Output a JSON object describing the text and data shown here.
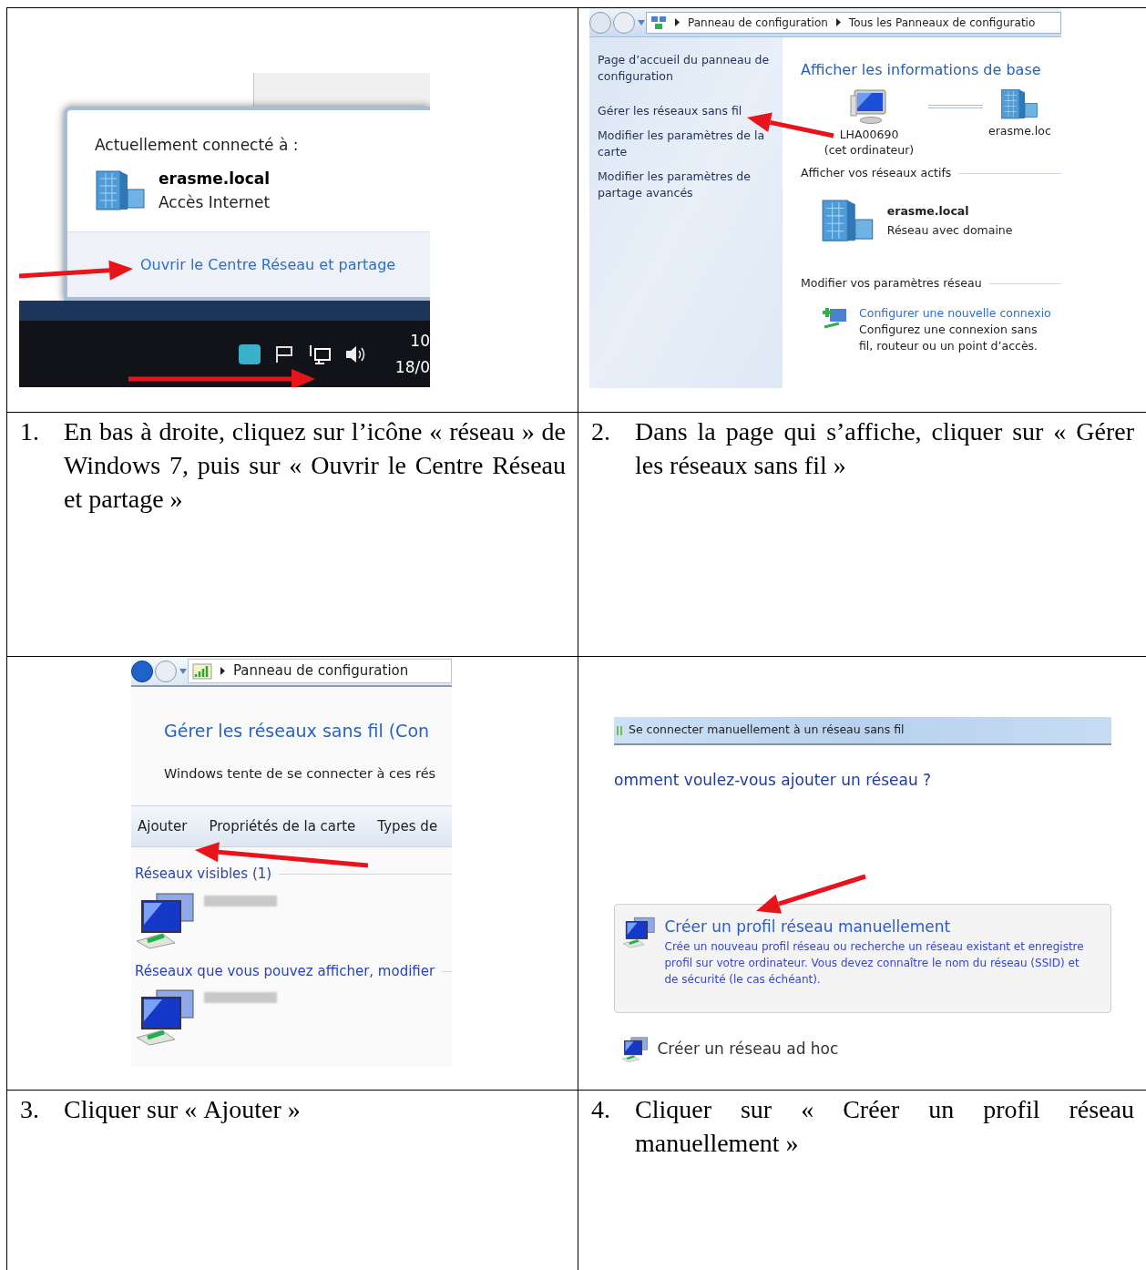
{
  "steps": [
    {
      "number": "1.",
      "caption": "En bas à droite, cliquez sur l’icône « réseau » de Windows 7, puis sur « Ouvrir le Centre Réseau et partage »",
      "screenshot": {
        "kind": "tray_popup",
        "heading": "Actuellement connecté à :",
        "network": "erasme.local",
        "status": "Accès Internet",
        "link": "Ouvrir le Centre Réseau et partage",
        "time": "10",
        "date": "18/0"
      }
    },
    {
      "number": "2.",
      "caption": "Dans la page qui s’affiche, cliquer sur « Gérer les réseaux sans fil »",
      "screenshot": {
        "kind": "network_center",
        "breadcrumb": [
          "Panneau de configuration",
          "Tous les Panneaux de configuratio"
        ],
        "sidebar": [
          "Page d’accueil du panneau de configuration",
          "Gérer les réseaux sans fil",
          "Modifier les paramètres de la carte",
          "Modifier les paramètres de partage avancés"
        ],
        "title": "Afficher les informations de base",
        "computer": "LHA00690",
        "computer_note": "(cet ordinateur)",
        "map_network": "erasme.loc",
        "active_header": "Afficher vos réseaux actifs",
        "active_name": "erasme.local",
        "active_type": "Réseau avec domaine",
        "settings_header": "Modifier vos paramètres réseau",
        "task_link": "Configurer une nouvelle connexio",
        "task_desc": "Configurez une connexion sans fil, routeur ou un point d’accès."
      }
    },
    {
      "number": "3.",
      "caption": "Cliquer sur « Ajouter »",
      "screenshot": {
        "kind": "wireless_networks",
        "breadcrumb": [
          "Panneau de configuration"
        ],
        "title": "Gérer les réseaux sans fil (Con",
        "subtitle": "Windows tente de se connecter à ces rés",
        "toolbar": [
          "Ajouter",
          "Propriétés de la carte",
          "Types de"
        ],
        "groups": [
          "Réseaux visibles (1)",
          "Réseaux que vous pouvez afficher, modifier"
        ]
      }
    },
    {
      "number": "4.",
      "caption": "Cliquer sur « Créer un profil réseau manuellement »",
      "screenshot": {
        "kind": "manual_connect",
        "window_title": "Se connecter manuellement à un réseau sans fil",
        "question": "omment voulez-vous ajouter un réseau ?",
        "options": [
          {
            "title": "Créer un profil réseau manuellement",
            "description": [
              "Crée un nouveau profil réseau ou recherche un réseau existant et enregistre",
              "profil sur votre ordinateur. Vous devez connaître le nom du réseau (SSID) et",
              "de sécurité (le cas échéant)."
            ],
            "boxed": true
          },
          {
            "title": "Créer un réseau ad hoc",
            "boxed": false
          }
        ]
      }
    }
  ]
}
